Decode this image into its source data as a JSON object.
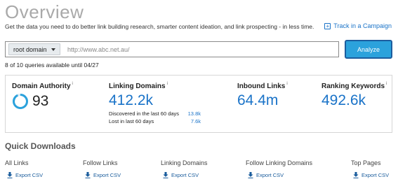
{
  "header": {
    "title": "Overview",
    "subtitle": "Get the data you need to do better link building research, smarter content ideation, and link prospecting - in less time.",
    "track_label": "Track in a Campaign"
  },
  "search": {
    "scope_selected": "root domain",
    "url_value": "http://www.abc.net.au/",
    "analyze_label": "Analyze",
    "quota_text": "8 of 10 queries available until 04/27"
  },
  "metrics": {
    "domain_authority": {
      "label": "Domain Authority",
      "info": "i",
      "value": "93",
      "ring_fraction": 0.93
    },
    "linking_domains": {
      "label": "Linking Domains",
      "info": "i",
      "value": "412.2k",
      "discovered_label": "Discovered in the last 60 days",
      "discovered_value": "13.8k",
      "lost_label": "Lost in last 60 days",
      "lost_value": "7.6k"
    },
    "inbound_links": {
      "label": "Inbound Links",
      "info": "i",
      "value": "64.4m"
    },
    "ranking_keywords": {
      "label": "Ranking Keywords",
      "info": "i",
      "value": "492.6k"
    }
  },
  "quick_downloads": {
    "title": "Quick Downloads",
    "export_label": "Export CSV",
    "items": [
      {
        "label": "All Links"
      },
      {
        "label": "Follow Links"
      },
      {
        "label": "Linking Domains"
      },
      {
        "label": "Follow Linking Domains"
      },
      {
        "label": "Top Pages"
      }
    ]
  },
  "colors": {
    "accent": "#1a73c8",
    "button": "#2ba2dc",
    "title_gray": "#a9a9a9"
  }
}
